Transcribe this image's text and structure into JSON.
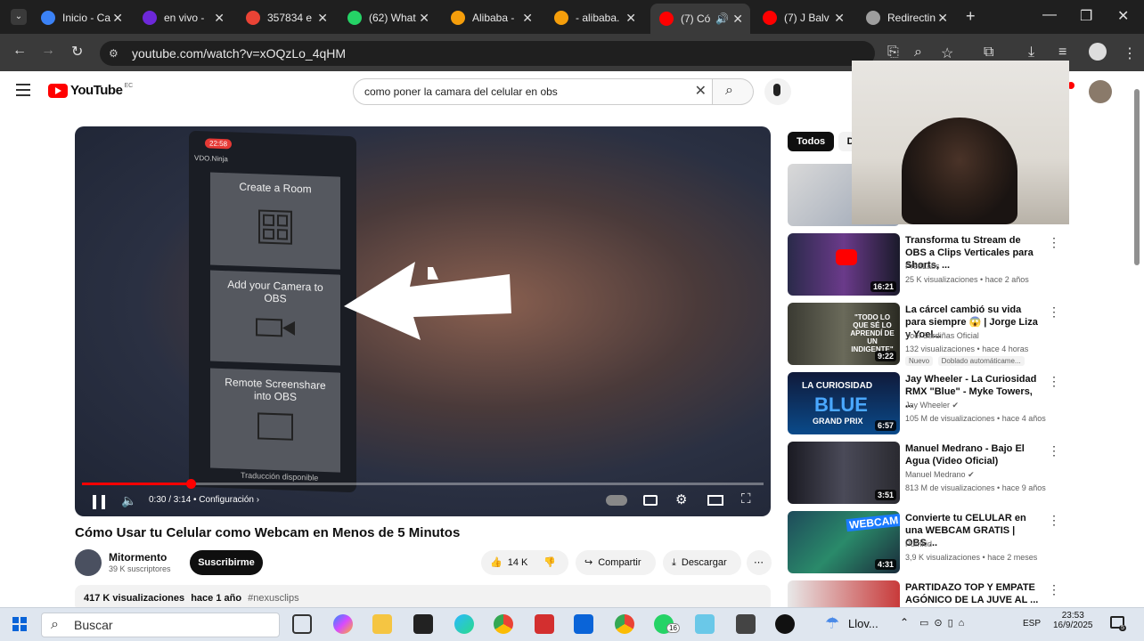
{
  "browser": {
    "tabs": [
      {
        "label": "Inicio - Ca",
        "color": "#3b82f6"
      },
      {
        "label": "en vivo -",
        "color": "#6d28d9"
      },
      {
        "label": "357834 e",
        "color": "#ea4335"
      },
      {
        "label": "(62) What",
        "color": "#25d366"
      },
      {
        "label": "Alibaba -",
        "color": "#f59e0b"
      },
      {
        "label": "- alibaba.",
        "color": "#f59e0b"
      },
      {
        "label": "(7) Có",
        "color": "#ff0000"
      },
      {
        "label": "(7) J Balv",
        "color": "#ff0000"
      },
      {
        "label": "Redirectin",
        "color": "#9e9e9e"
      }
    ],
    "url": "youtube.com/watch?v=xOQzLo_4qHM"
  },
  "youtube": {
    "logo_text": "YouTube",
    "country_code": "EC",
    "search_value": "como poner la camara del celular en obs"
  },
  "player": {
    "phone_clock": "22:58",
    "phone_app": "VDO.Ninja",
    "phone_options": [
      "Create a Room",
      "Add your Camera to OBS",
      "Remote Screenshare into OBS"
    ],
    "phone_bottom_text": "Traducción disponible",
    "time": "0:30 / 3:14",
    "settings_label": "Configuración",
    "progress_fraction": 0.16
  },
  "video": {
    "title": "Cómo Usar tu Celular como Webcam en Menos de 5 Minutos",
    "channel": "Mitormento",
    "subscribers": "39 K suscriptores",
    "subscribe_label": "Suscribirme",
    "likes": "14 K",
    "share_label": "Compartir",
    "download_label": "Descargar",
    "views": "417 K visualizaciones",
    "age": "hace 1 año",
    "hashtag": "#nexusclips"
  },
  "chips": [
    "Todos",
    "De"
  ],
  "recommendations": [
    {
      "title": "Transforma tu Stream de OBS a Clips Verticales para Shorts, ...",
      "channel": "PredLabs",
      "meta": "25 K visualizaciones • hace 2 años",
      "duration": "16:21",
      "badges": []
    },
    {
      "title": "La cárcel cambió su vida para siempre 😱 | Jorge Liza y Yoel...",
      "channel": "Yoel Sardiñas Oficial",
      "meta": "132 visualizaciones • hace 4 horas",
      "duration": "9:22",
      "badges": [
        "Nuevo",
        "Doblado automáticame..."
      ]
    },
    {
      "title": "Jay Wheeler - La Curiosidad RMX \"Blue\" - Myke Towers, ...",
      "channel": "Jay Wheeler",
      "meta": "105 M de visualizaciones • hace 4 años",
      "duration": "6:57",
      "badges": []
    },
    {
      "title": "Manuel Medrano - Bajo El Agua (Video Oficial)",
      "channel": "Manuel Medrano",
      "meta": "813 M de visualizaciones • hace 9 años",
      "duration": "3:51",
      "badges": []
    },
    {
      "title": "Convierte tu CELULAR en una WEBCAM GRATIS | OBS ...",
      "channel": "Pumkid",
      "meta": "3,9 K visualizaciones • hace 2 meses",
      "duration": "4:31",
      "badges": []
    },
    {
      "title": "PARTIDAZO TOP Y EMPATE AGÓNICO DE LA JUVE AL ...",
      "channel": "",
      "meta": "",
      "duration": "",
      "badges": []
    }
  ],
  "thumb_texts": {
    "t2": "\"TODO LO QUE SÉ LO APRENDÍ DE UN INDIGENTE\"",
    "t3_top": "LA CURIOSIDAD",
    "t3_mid": "BLUE",
    "t3_bot": "GRAND PRIX",
    "t5": "WEBCAM"
  },
  "taskbar": {
    "search_placeholder": "Buscar",
    "weather": "Llov...",
    "lang": "ESP",
    "time": "23:53",
    "date": "16/9/2025",
    "whatsapp_count": "16",
    "notif_count": "5"
  }
}
